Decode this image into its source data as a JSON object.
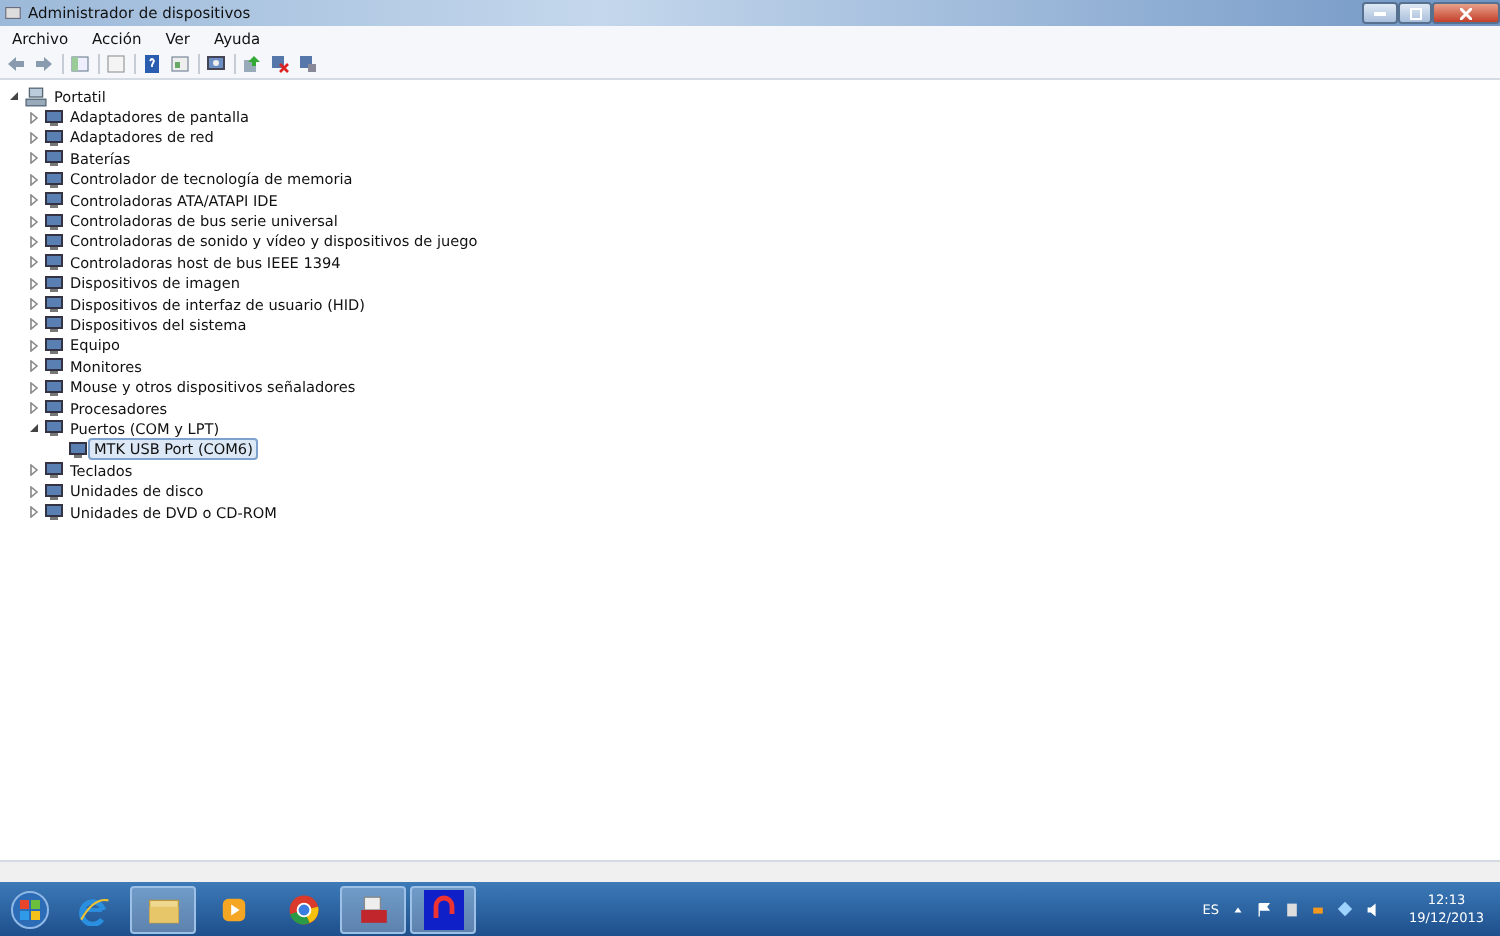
{
  "window": {
    "title": "Administrador de dispositivos"
  },
  "menu": [
    "Archivo",
    "Acción",
    "Ver",
    "Ayuda"
  ],
  "tree": {
    "label": "Portatil",
    "expanded": true,
    "selected": false,
    "children": [
      {
        "label": "Adaptadores de pantalla",
        "expanded": false,
        "selected": false
      },
      {
        "label": "Adaptadores de red",
        "expanded": false,
        "selected": false
      },
      {
        "label": "Baterías",
        "expanded": false,
        "selected": false
      },
      {
        "label": "Controlador de tecnología de memoria",
        "expanded": false,
        "selected": false
      },
      {
        "label": "Controladoras ATA/ATAPI IDE",
        "expanded": false,
        "selected": false
      },
      {
        "label": "Controladoras de bus serie universal",
        "expanded": false,
        "selected": false
      },
      {
        "label": "Controladoras de sonido y vídeo y dispositivos de juego",
        "expanded": false,
        "selected": false
      },
      {
        "label": "Controladoras host de bus IEEE 1394",
        "expanded": false,
        "selected": false
      },
      {
        "label": "Dispositivos de imagen",
        "expanded": false,
        "selected": false
      },
      {
        "label": "Dispositivos de interfaz de usuario (HID)",
        "expanded": false,
        "selected": false
      },
      {
        "label": "Dispositivos del sistema",
        "expanded": false,
        "selected": false
      },
      {
        "label": "Equipo",
        "expanded": false,
        "selected": false
      },
      {
        "label": "Monitores",
        "expanded": false,
        "selected": false
      },
      {
        "label": "Mouse y otros dispositivos señaladores",
        "expanded": false,
        "selected": false
      },
      {
        "label": "Procesadores",
        "expanded": false,
        "selected": false
      },
      {
        "label": "Puertos (COM y LPT)",
        "expanded": true,
        "selected": false,
        "children": [
          {
            "label": "MTK USB Port (COM6)",
            "selected": true
          }
        ]
      },
      {
        "label": "Teclados",
        "expanded": false,
        "selected": false
      },
      {
        "label": "Unidades de disco",
        "expanded": false,
        "selected": false
      },
      {
        "label": "Unidades de DVD o CD-ROM",
        "expanded": false,
        "selected": false
      }
    ]
  },
  "taskbar": {
    "apps": [
      {
        "kind": "browser-e",
        "running": false
      },
      {
        "kind": "folder",
        "running": true
      },
      {
        "kind": "media",
        "running": false
      },
      {
        "kind": "chrome",
        "running": false
      },
      {
        "kind": "toolbox",
        "running": true
      },
      {
        "kind": "blue",
        "running": true
      }
    ],
    "language": "ES",
    "time": "12:13",
    "date": "19/12/2013"
  }
}
